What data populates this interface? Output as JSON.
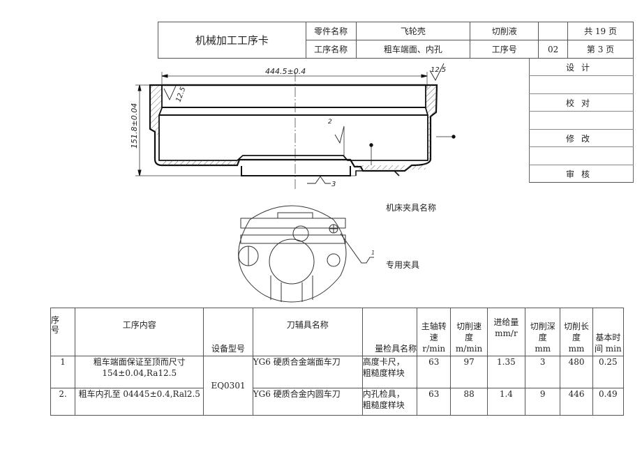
{
  "header": {
    "title": "机械加工工序卡",
    "part_name_label": "零件名称",
    "part_name_value": "飞轮壳",
    "coolant_label": "切削液",
    "coolant_value": "",
    "total_pages": "共 19 页",
    "operation_name_label": "工序名称",
    "operation_name_value": "粗车端面、内孔",
    "operation_no_label": "工序号",
    "operation_no_value": "02",
    "page_no": "第 3 页"
  },
  "signoff": {
    "rows": [
      {
        "label": "设计",
        "value": ""
      },
      {
        "label": "校对",
        "value": ""
      },
      {
        "label": "修改",
        "value": ""
      },
      {
        "label": "审核",
        "value": ""
      }
    ]
  },
  "drawing": {
    "dim_width": "444.5±0.4",
    "dim_height": "151.8±0.04",
    "roughness_top": "12.5",
    "roughness_left": "12.5",
    "roughness_mark_2": "2",
    "roughness_mark_3": "3",
    "roughness_mark_1": "1"
  },
  "fixture": {
    "label": "机床夹具名称",
    "value": "专用夹具"
  },
  "process_table": {
    "headers": {
      "seq": "序号",
      "content": "工序内容",
      "equipment": "设备型号",
      "tool": "刀辅具名称",
      "gauge": "量检具名称",
      "spindle_a": "主轴转",
      "spindle_b": "速 r/min",
      "speed_a": "切削速",
      "speed_b": "度 m/min",
      "feed_a": "进给量",
      "feed_b": "mm/r",
      "depth_a": "切削深",
      "depth_b": "度",
      "depth_c": "mm",
      "length_a": "切削长",
      "length_b": "度",
      "length_c": "mm",
      "time_a": "基本时",
      "time_b": "间 min"
    },
    "equipment_value": "EQ0301",
    "rows": [
      {
        "seq": "1",
        "content_line1": "粗车端面保证至顶而尺寸",
        "content_line2": "154±0.04,Ra12.5",
        "tool": "YG6 硬质合金端面车刀",
        "gauge_line1": "高度卡尺，",
        "gauge_line2": "粗糙度样块",
        "spindle": "63",
        "speed": "97",
        "feed": "1.35",
        "depth": "3",
        "length": "480",
        "time": "0.25"
      },
      {
        "seq": "2.",
        "content_line1": "粗车内孔至 04445±0.4,Ral2.5",
        "content_line2": "",
        "tool": "YG6 硬质合金内圆车刀",
        "gauge_line1": "内孔检具，",
        "gauge_line2": "粗糙度样块",
        "spindle": "63",
        "speed": "88",
        "feed": "1.4",
        "depth": "9",
        "length": "446",
        "time": "0.49"
      }
    ]
  }
}
